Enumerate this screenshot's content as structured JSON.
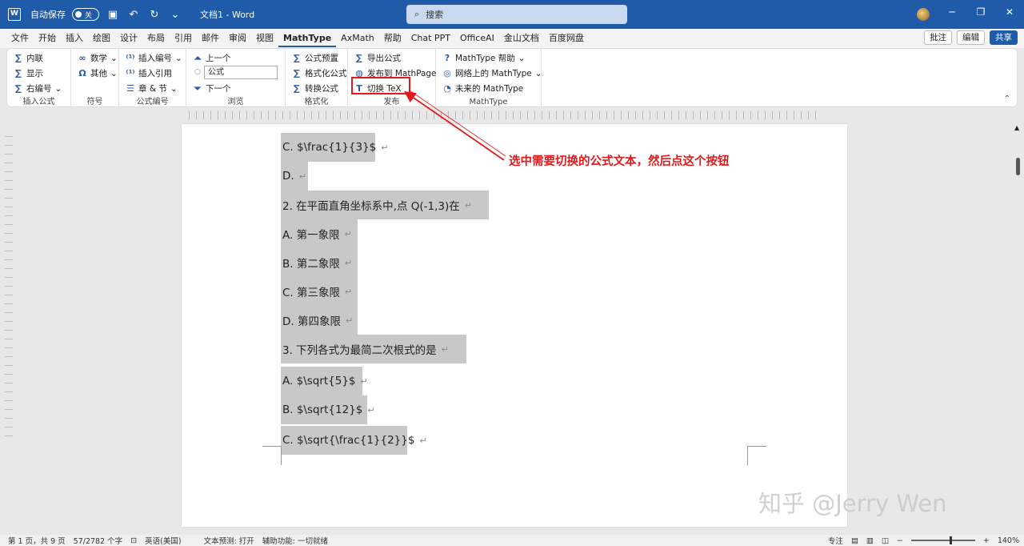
{
  "titlebar": {
    "app_icon": "word-icon",
    "autosave_label": "自动保存",
    "autosave_state": "关",
    "doc_title": "文档1 - Word",
    "search_placeholder": "搜索"
  },
  "menu": {
    "tabs": [
      "文件",
      "开始",
      "插入",
      "绘图",
      "设计",
      "布局",
      "引用",
      "邮件",
      "审阅",
      "视图",
      "MathType",
      "AxMath",
      "帮助",
      "Chat PPT",
      "OfficeAI",
      "金山文档",
      "百度网盘"
    ],
    "active_tab": "MathType",
    "comment_btn": "批注",
    "edit_btn": "编辑",
    "share_btn": "共享"
  },
  "ribbon": {
    "insert_group": {
      "items": [
        "内联",
        "显示",
        "右编号"
      ],
      "label": "插入公式"
    },
    "symbol_group": {
      "items": [
        "数学",
        "其他"
      ],
      "label": "符号"
    },
    "numbering_group": {
      "items": [
        "插入编号",
        "插入引用",
        "章 & 节"
      ],
      "label": "公式编号"
    },
    "browse_group": {
      "prev": "上一个",
      "combo_value": "公式",
      "next": "下一个",
      "label": "浏览"
    },
    "format_group": {
      "items": [
        "公式预置",
        "格式化公式",
        "转换公式"
      ],
      "label": "格式化"
    },
    "publish_group": {
      "items": [
        "导出公式",
        "发布到 MathPage",
        "切换 TeX"
      ],
      "label": "发布"
    },
    "mathtype_group": {
      "items": [
        "MathType 帮助",
        "网络上的 MathType",
        "未来的 MathType"
      ],
      "label": "MathType"
    }
  },
  "document": {
    "lines": [
      "C. $\\frac{1}{3}$",
      "D.",
      "2.  在平面直角坐标系中,点  Q(-1,3)在",
      "A.  第一象限",
      "B.  第二象限",
      "C.  第三象限",
      "D.  第四象限",
      "3.  下列各式为最简二次根式的是",
      "A. $\\sqrt{5}$",
      "B. $\\sqrt{12}$",
      "C. $\\sqrt{\\frac{1}{2}}$"
    ],
    "paragraph_mark": "↵"
  },
  "annotation": {
    "text": "选中需要切换的公式文本，然后点这个按钮",
    "color": "#e0191b"
  },
  "watermark": "知乎 @Jerry Wen",
  "statusbar": {
    "page_info": "第 1 页，共 9 页",
    "word_count": "57/2782 个字",
    "language": "英语(美国)",
    "text_prediction": "文本预测: 打开",
    "accessibility": "辅助功能: 一切就绪",
    "focus": "专注",
    "zoom": "140%"
  },
  "colors": {
    "titlebar": "#1f5ba8",
    "selection": "#c8c8c8",
    "highlight": "#e0191b"
  }
}
